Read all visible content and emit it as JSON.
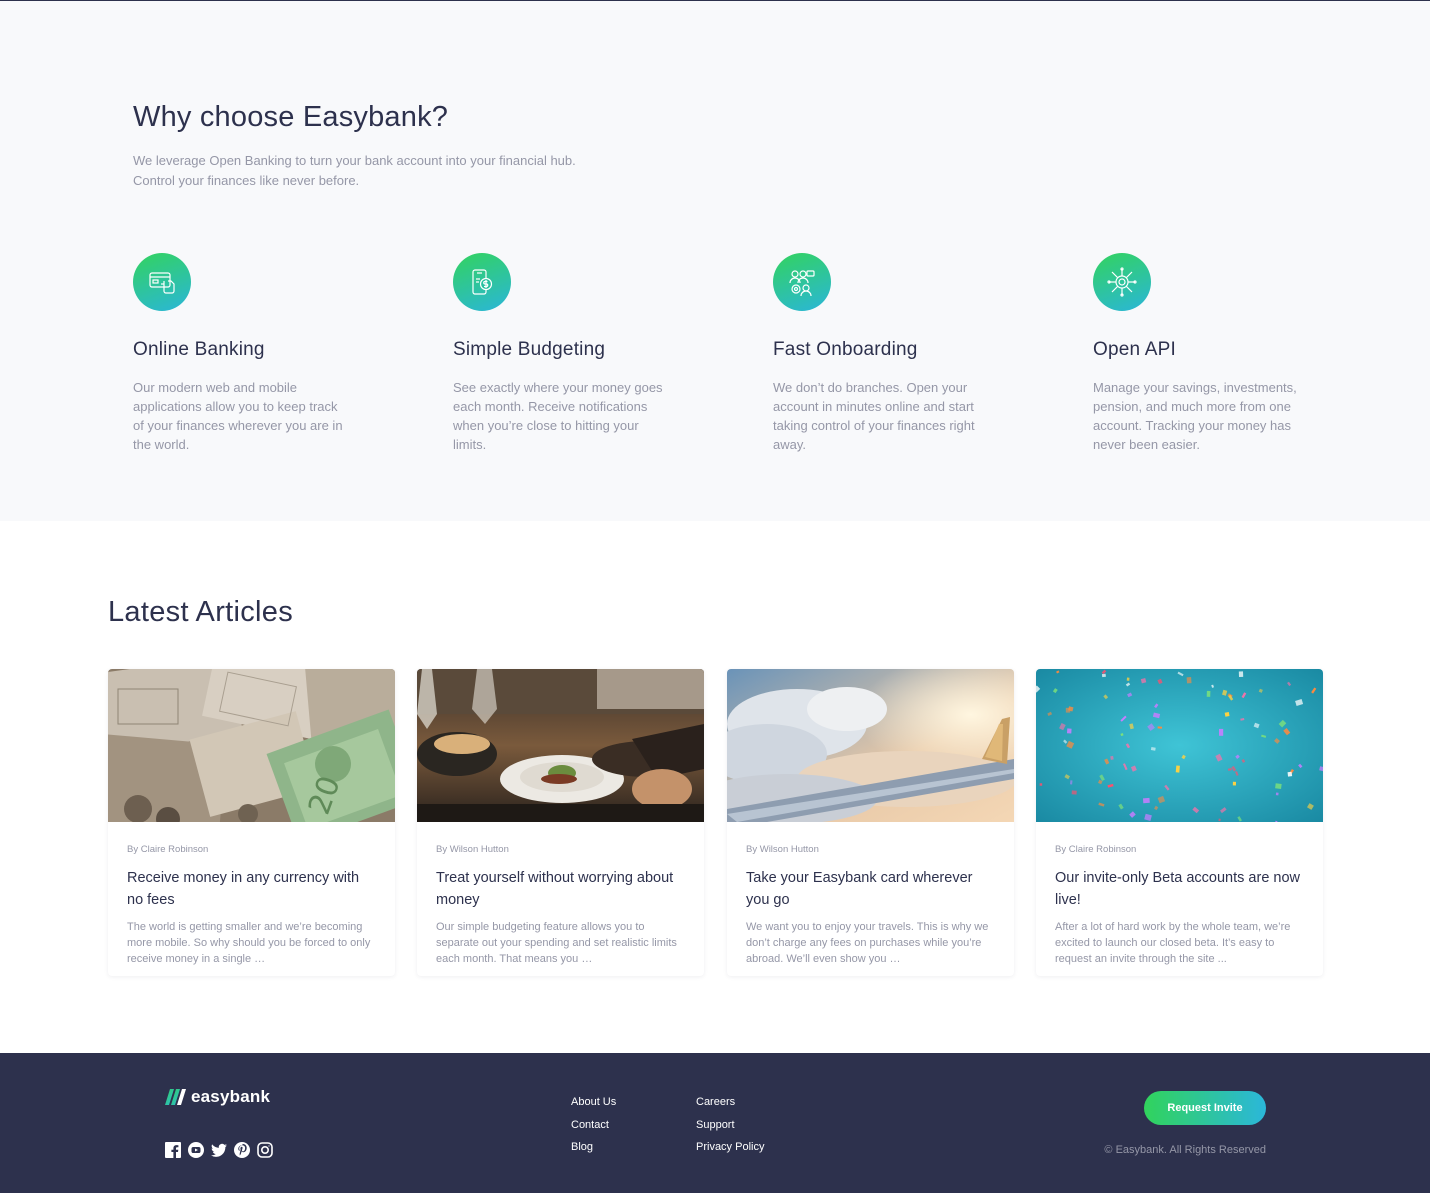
{
  "why": {
    "title": "Why choose Easybank?",
    "intro_line1": "We leverage Open Banking to turn your bank account into your financial hub.",
    "intro_line2": "Control your finances like never before.",
    "features": [
      {
        "title": "Online Banking",
        "text": "Our modern web and mobile applications allow you to keep track of your finances wherever you are in the world.",
        "icon": "online-banking-icon"
      },
      {
        "title": "Simple Budgeting",
        "text": "See exactly where your money goes each month. Receive notifications when you’re close to hitting your limits.",
        "icon": "budgeting-icon"
      },
      {
        "title": "Fast Onboarding",
        "text": "We don’t do branches. Open your account in minutes online and start taking control of your finances right away.",
        "icon": "onboarding-icon"
      },
      {
        "title": "Open API",
        "text": "Manage your savings, investments, pension, and much more from one account. Tracking your money has never been easier.",
        "icon": "api-icon"
      }
    ]
  },
  "articles": {
    "title": "Latest Articles",
    "items": [
      {
        "author": "By Claire Robinson",
        "title": "Receive money in any currency with no fees",
        "excerpt": "The world is getting smaller and we’re becoming more mobile. So why should you be forced to only receive money in a single …",
        "image": "currency-photo"
      },
      {
        "author": "By Wilson Hutton",
        "title": "Treat yourself without worrying about money",
        "excerpt": "Our simple budgeting feature allows you to separate out your spending and set realistic limits each month. That means you …",
        "image": "restaurant-photo"
      },
      {
        "author": "By Wilson Hutton",
        "title": "Take your Easybank card wherever you go",
        "excerpt": "We want you to enjoy your travels. This is why we don’t charge any fees on purchases while you’re abroad. We’ll even show you …",
        "image": "plane-photo"
      },
      {
        "author": "By Claire Robinson",
        "title": "Our invite-only Beta accounts are now live!",
        "excerpt": "After a lot of hard work by the whole team, we’re excited to launch our closed beta. It’s easy to request an invite through the site ...",
        "image": "confetti-photo"
      }
    ]
  },
  "footer": {
    "logo": "easybank",
    "socials": [
      "facebook-icon",
      "youtube-icon",
      "twitter-icon",
      "pinterest-icon",
      "instagram-icon"
    ],
    "links_col1": [
      "About Us",
      "Contact",
      "Blog"
    ],
    "links_col2": [
      "Careers",
      "Support",
      "Privacy Policy"
    ],
    "cta": "Request Invite",
    "copyright": "© Easybank. All Rights Reserved"
  },
  "colors": {
    "dark_blue": "#2d314d",
    "lime_green": "#31d35c",
    "bright_cyan": "#2bb7da",
    "grayish_blue": "#9597a7",
    "light_gray": "#f8f9fb"
  }
}
